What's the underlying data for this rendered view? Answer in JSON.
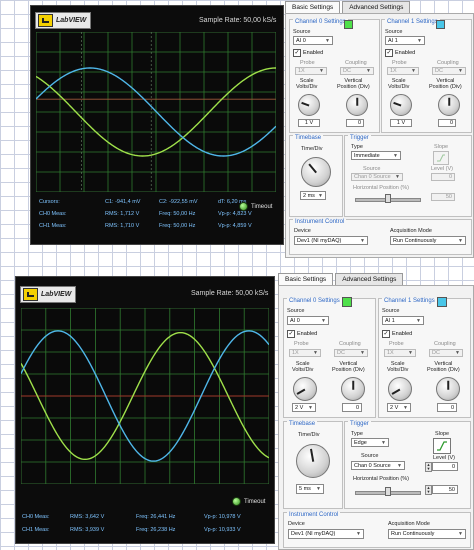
{
  "colors": {
    "ch0_trace": "#9fe04a",
    "ch1_trace": "#4fb6e8",
    "ch0_swatch": "#4fe04a",
    "ch1_swatch": "#49c6e8",
    "grid": "#2f7a2f",
    "accent": "#2c66c4"
  },
  "top": {
    "logo": "LabVIEW",
    "sample_rate": "Sample Rate:  50,00 kS/s",
    "cursors": {
      "label": "Cursors:",
      "c1": "C1:  -941,4 mV",
      "c2": "C2:  -922,55 mV",
      "dt": "dT:  6,20 ms"
    },
    "ch0_row": {
      "label": "CH0 Meas:",
      "rms": "RMS:  1,712 V",
      "freq": "Freq:  50,00 Hz",
      "vpp": "Vp-p:  4,823 V"
    },
    "ch1_row": {
      "label": "CH1 Meas:",
      "rms": "RMS:  1,710 V",
      "freq": "Freq:  50,00 Hz",
      "vpp": "Vp-p:  4,859 V"
    },
    "timeout": "Timeout",
    "tabs": [
      "Basic Settings",
      "Advanced Settings"
    ],
    "ch0": {
      "title": "Channel 0 Settings",
      "source_label": "Source",
      "source": "AI 0",
      "enabled": "Enabled",
      "probe_label": "Probe",
      "probe": "1X",
      "coupling_label": "Coupling",
      "coupling": "DC",
      "scale_label": "Scale\nVolts/Div",
      "pos_label": "Vertical\nPosition (Div)",
      "scale": "1 V",
      "pos": "0"
    },
    "ch1": {
      "title": "Channel 1 Settings",
      "source_label": "Source",
      "source": "AI 1",
      "enabled": "Enabled",
      "probe_label": "Probe",
      "probe": "1X",
      "coupling_label": "Coupling",
      "coupling": "DC",
      "scale_label": "Scale\nVolts/Div",
      "pos_label": "Vertical\nPosition (Div)",
      "scale": "1 V",
      "pos": "0"
    },
    "timebase": {
      "title": "Timebase",
      "label": "Time/Div",
      "value": "2 ms"
    },
    "trigger": {
      "title": "Trigger",
      "type_label": "Type",
      "type": "Immediate",
      "slope_label": "Slope",
      "source_label": "Source",
      "source": "Chan 0 Source",
      "level_label": "Level (V)",
      "level": "0",
      "hpos_label": "Horizontal Position (%)",
      "hpos": "50"
    },
    "instrument": {
      "title": "Instrument Control",
      "device_label": "Device",
      "device": "Dev1 (NI myDAQ)",
      "mode_label": "Acquisition Mode",
      "mode": "Run Continuously"
    }
  },
  "bottom": {
    "logo": "LabVIEW",
    "sample_rate": "Sample Rate:  50,00 kS/s",
    "ch0_row": {
      "label": "CH0 Meas:",
      "rms": "RMS:  3,642 V",
      "freq": "Freq:  26,441 Hz",
      "vpp": "Vp-p:  10,978 V"
    },
    "ch1_row": {
      "label": "CH1 Meas:",
      "rms": "RMS:  3,939 V",
      "freq": "Freq:  26,238 Hz",
      "vpp": "Vp-p:  10,933 V"
    },
    "timeout": "Timeout",
    "tabs": [
      "Basic Settings",
      "Advanced Settings"
    ],
    "ch0": {
      "title": "Channel 0 Settings",
      "source_label": "Source",
      "source": "AI 0",
      "enabled": "Enabled",
      "probe_label": "Probe",
      "probe": "1X",
      "coupling_label": "Coupling",
      "coupling": "DC",
      "scale_label": "Scale\nVolts/Div",
      "pos_label": "Vertical\nPosition (Div)",
      "scale": "2 V",
      "pos": "0"
    },
    "ch1": {
      "title": "Channel 1 Settings",
      "source_label": "Source",
      "source": "AI 1",
      "enabled": "Enabled",
      "probe_label": "Probe",
      "probe": "1X",
      "coupling_label": "Coupling",
      "coupling": "DC",
      "scale_label": "Scale\nVolts/Div",
      "pos_label": "Vertical\nPosition (Div)",
      "scale": "2 V",
      "pos": "0"
    },
    "timebase": {
      "title": "Timebase",
      "label": "Time/Div",
      "value": "5 ms"
    },
    "trigger": {
      "title": "Trigger",
      "type_label": "Type",
      "type": "Edge",
      "slope_label": "Slope",
      "source_label": "Source",
      "source": "Chan 0 Source",
      "level_label": "Level (V)",
      "level": "0",
      "hpos_label": "Horizontal Position (%)",
      "hpos": "50"
    },
    "instrument": {
      "title": "Instrument Control",
      "device_label": "Device",
      "device": "Dev1 (NI myDAQ)",
      "mode_label": "Acquisition Mode",
      "mode": "Run Continuously"
    }
  }
}
